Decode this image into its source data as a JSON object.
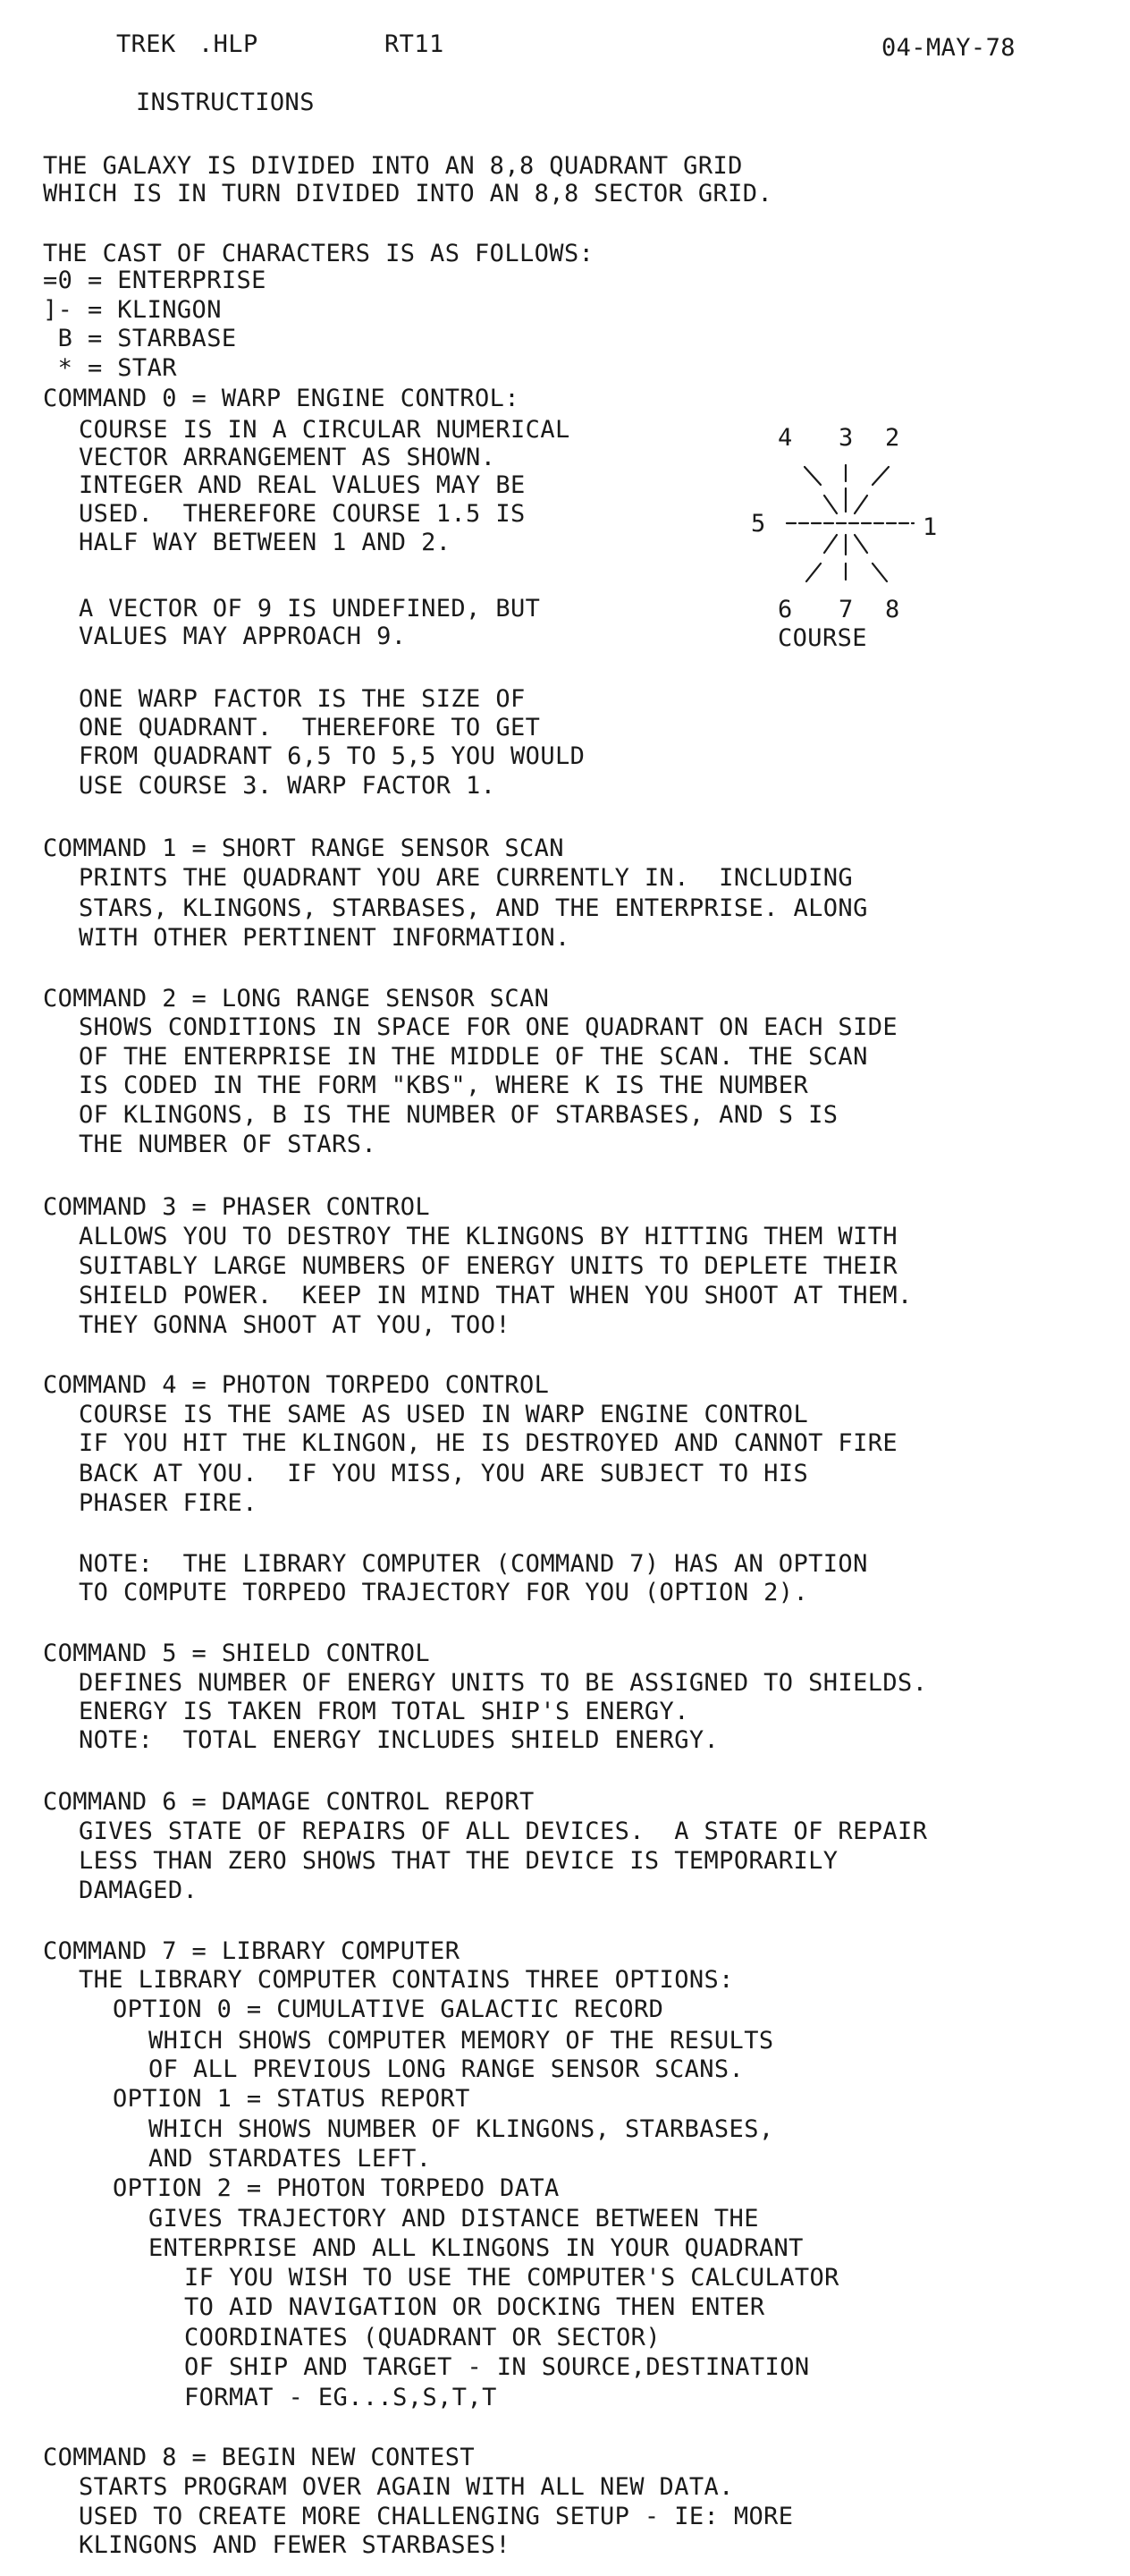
{
  "header": {
    "file": "TREK",
    "ext": ".HLP",
    "system": "RT11",
    "date": "04-MAY-78"
  },
  "heading": "INSTRUCTIONS",
  "intro": [
    "THE GALAXY IS DIVIDED INTO AN 8,8 QUADRANT GRID",
    "WHICH IS IN TURN DIVIDED INTO AN 8,8 SECTOR GRID."
  ],
  "cast": {
    "title": "THE CAST OF CHARACTERS IS AS FOLLOWS:",
    "items": [
      "=0 = ENTERPRISE",
      "]- = KLINGON",
      " B = STARBASE",
      " * = STAR"
    ]
  },
  "commands": [
    {
      "title": "COMMAND 0 = WARP ENGINE CONTROL:",
      "lines": [
        "COURSE IS IN A CIRCULAR NUMERICAL",
        "VECTOR ARRANGEMENT AS SHOWN.",
        "INTEGER AND REAL VALUES MAY BE",
        "USED.  THEREFORE COURSE 1.5 IS",
        "HALF WAY BETWEEN 1 AND 2.",
        "A VECTOR OF 9 IS UNDEFINED, BUT",
        "VALUES MAY APPROACH 9.",
        "ONE WARP FACTOR IS THE SIZE OF",
        "ONE QUADRANT.  THEREFORE TO GET",
        "FROM QUADRANT 6,5 TO 5,5 YOU WOULD",
        "USE COURSE 3. WARP FACTOR 1."
      ]
    },
    {
      "title": "COMMAND 1 = SHORT RANGE SENSOR SCAN",
      "lines": [
        "PRINTS THE QUADRANT YOU ARE CURRENTLY IN.  INCLUDING",
        "STARS, KLINGONS, STARBASES, AND THE ENTERPRISE. ALONG",
        "WITH OTHER PERTINENT INFORMATION."
      ]
    },
    {
      "title": "COMMAND 2 = LONG RANGE SENSOR SCAN",
      "lines": [
        "SHOWS CONDITIONS IN SPACE FOR ONE QUADRANT ON EACH SIDE",
        "OF THE ENTERPRISE IN THE MIDDLE OF THE SCAN. THE SCAN",
        "IS CODED IN THE FORM \"KBS\", WHERE K IS THE NUMBER",
        "OF KLINGONS, B IS THE NUMBER OF STARBASES, AND S IS",
        "THE NUMBER OF STARS."
      ]
    },
    {
      "title": "COMMAND 3 = PHASER CONTROL",
      "lines": [
        "ALLOWS YOU TO DESTROY THE KLINGONS BY HITTING THEM WITH",
        "SUITABLY LARGE NUMBERS OF ENERGY UNITS TO DEPLETE THEIR",
        "SHIELD POWER.  KEEP IN MIND THAT WHEN YOU SHOOT AT THEM.",
        "THEY GONNA SHOOT AT YOU, TOO!"
      ]
    },
    {
      "title": "COMMAND 4 = PHOTON TORPEDO CONTROL",
      "lines": [
        "COURSE IS THE SAME AS USED IN WARP ENGINE CONTROL",
        "IF YOU HIT THE KLINGON, HE IS DESTROYED AND CANNOT FIRE",
        "BACK AT YOU.  IF YOU MISS, YOU ARE SUBJECT TO HIS",
        "PHASER FIRE.",
        "NOTE:  THE LIBRARY COMPUTER (COMMAND 7) HAS AN OPTION",
        "TO COMPUTE TORPEDO TRAJECTORY FOR YOU (OPTION 2)."
      ]
    },
    {
      "title": "COMMAND 5 = SHIELD CONTROL",
      "lines": [
        "DEFINES NUMBER OF ENERGY UNITS TO BE ASSIGNED TO SHIELDS.",
        "ENERGY IS TAKEN FROM TOTAL SHIP'S ENERGY.",
        "NOTE:  TOTAL ENERGY INCLUDES SHIELD ENERGY."
      ]
    },
    {
      "title": "COMMAND 6 = DAMAGE CONTROL REPORT",
      "lines": [
        "GIVES STATE OF REPAIRS OF ALL DEVICES.  A STATE OF REPAIR",
        "LESS THAN ZERO SHOWS THAT THE DEVICE IS TEMPORARILY",
        "DAMAGED."
      ]
    },
    {
      "title": "COMMAND 7 = LIBRARY COMPUTER",
      "lines": [
        "THE LIBRARY COMPUTER CONTAINS THREE OPTIONS:",
        "OPTION 0 = CUMULATIVE GALACTIC RECORD",
        "WHICH SHOWS COMPUTER MEMORY OF THE RESULTS",
        "OF ALL PREVIOUS LONG RANGE SENSOR SCANS.",
        "OPTION 1 = STATUS REPORT",
        "WHICH SHOWS NUMBER OF KLINGONS, STARBASES,",
        "AND STARDATES LEFT.",
        "OPTION 2 = PHOTON TORPEDO DATA",
        "GIVES TRAJECTORY AND DISTANCE BETWEEN THE",
        "ENTERPRISE AND ALL KLINGONS IN YOUR QUADRANT",
        "IF YOU WISH TO USE THE COMPUTER'S CALCULATOR",
        "TO AID NAVIGATION OR DOCKING THEN ENTER",
        "COORDINATES (QUADRANT OR SECTOR)",
        "OF SHIP AND TARGET - IN SOURCE,DESTINATION",
        "FORMAT - EG...S,S,T,T"
      ]
    },
    {
      "title": "COMMAND 8 = BEGIN NEW CONTEST",
      "lines": [
        "STARTS PROGRAM OVER AGAIN WITH ALL NEW DATA.",
        "USED TO CREATE MORE CHALLENGING SETUP - IE: MORE",
        "KLINGONS AND FEWER STARBASES!"
      ]
    }
  ],
  "course_diagram": {
    "top_numbers": [
      "4",
      "3",
      "2"
    ],
    "left_number": "5",
    "right_number": "1",
    "bottom_numbers": [
      "6",
      "7",
      "8"
    ],
    "label": "COURSE"
  }
}
